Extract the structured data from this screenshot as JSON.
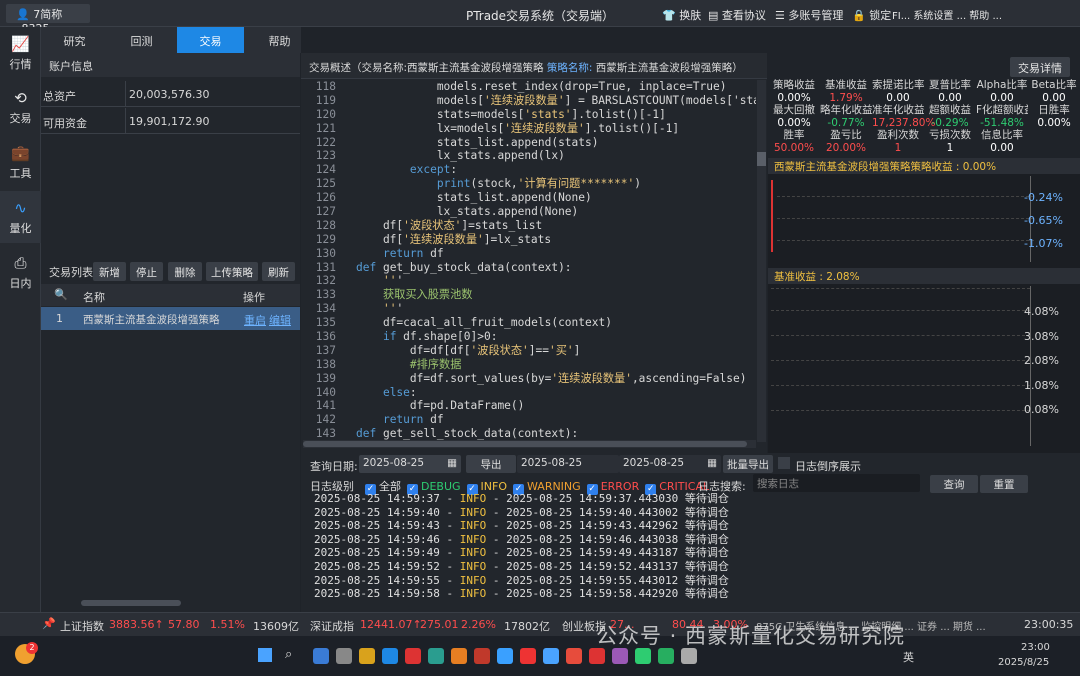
{
  "window": {
    "account": "7简称_8325",
    "title": "PTrade交易系统（交易端）",
    "toolbar": [
      "换肤",
      "查看协议",
      "多账号管理",
      "锁定"
    ],
    "toolbar_tail": "FI... 系统设置 ... 帮助 ..."
  },
  "sidebar": [
    {
      "label": "行情",
      "icon": "chart-icon"
    },
    {
      "label": "交易",
      "icon": "exchange-icon"
    },
    {
      "label": "工具",
      "icon": "toolbox-icon"
    },
    {
      "label": "量化",
      "icon": "quant-icon"
    },
    {
      "label": "日内",
      "icon": "intraday-icon"
    }
  ],
  "nav_tabs": [
    "研究",
    "回测",
    "交易",
    "帮助"
  ],
  "account": {
    "header": "账户信息",
    "rows": [
      {
        "k": "总资产",
        "v": "20,003,576.30"
      },
      {
        "k": "可用资金",
        "v": "19,901,172.90"
      }
    ]
  },
  "trade_list": {
    "title": "交易列表",
    "buttons": [
      "新增",
      "停止",
      "删除",
      "上传策略",
      "刷新"
    ],
    "columns": [
      "名称",
      "操作"
    ],
    "row": {
      "idx": "1",
      "name": "西蒙斯主流基金波段增强策略",
      "ops": [
        "重启",
        "编辑"
      ]
    }
  },
  "overview": {
    "prefix": "交易概述（交易名称:",
    "trade_name": "西蒙斯主流基金波段增强策略",
    "strategy_label": "策略名称:",
    "strategy_name": "西蒙斯主流基金波段增强策略）",
    "detail_button": "交易详情"
  },
  "code_lines": [
    {
      "n": "118",
      "t": "            models.reset_index(drop=True, inplace=True)"
    },
    {
      "n": "119",
      "t": "            models['连续波段数量'] = BARSLASTCOUNT(models['sta"
    },
    {
      "n": "120",
      "t": "            stats=models['stats'].tolist()[-1]"
    },
    {
      "n": "121",
      "t": "            lx=models['连续波段数量'].tolist()[-1]"
    },
    {
      "n": "122",
      "t": "            stats_list.append(stats)"
    },
    {
      "n": "123",
      "t": "            lx_stats.append(lx)"
    },
    {
      "n": "124",
      "t": "        except:"
    },
    {
      "n": "125",
      "t": "            print(stock,'计算有问题*******')"
    },
    {
      "n": "126",
      "t": "            stats_list.append(None)"
    },
    {
      "n": "127",
      "t": "            lx_stats.append(None)"
    },
    {
      "n": "128",
      "t": "    df['波段状态']=stats_list"
    },
    {
      "n": "129",
      "t": "    df['连续波段数量']=lx_stats"
    },
    {
      "n": "130",
      "t": "    return df"
    },
    {
      "n": "131",
      "t": "def get_buy_stock_data(context):"
    },
    {
      "n": "132",
      "t": "    '''"
    },
    {
      "n": "133",
      "t": "    获取买入股票池数"
    },
    {
      "n": "134",
      "t": "    '''"
    },
    {
      "n": "135",
      "t": "    df=cacal_all_fruit_models(context)"
    },
    {
      "n": "136",
      "t": "    if df.shape[0]>0:"
    },
    {
      "n": "137",
      "t": "        df=df[df['波段状态']=='买']"
    },
    {
      "n": "138",
      "t": "        #排序数据"
    },
    {
      "n": "139",
      "t": "        df=df.sort_values(by='连续波段数量',ascending=False)"
    },
    {
      "n": "140",
      "t": "    else:"
    },
    {
      "n": "141",
      "t": "        df=pd.DataFrame()"
    },
    {
      "n": "142",
      "t": "    return df"
    },
    {
      "n": "143",
      "t": "def get_sell_stock_data(context):"
    }
  ],
  "stats": [
    {
      "label": "策略收益",
      "value": "0.00%",
      "color": "#ffffff"
    },
    {
      "label": "基准收益",
      "value": "1.79%",
      "color": "#ff4d4d"
    },
    {
      "label": "索提诺比率",
      "value": "0.00",
      "color": "#ffffff"
    },
    {
      "label": "夏普比率",
      "value": "0.00",
      "color": "#ffffff"
    },
    {
      "label": "Alpha比率",
      "value": "0.00",
      "color": "#ffffff"
    },
    {
      "label": "Beta比率",
      "value": "0.00",
      "color": "#ffffff"
    },
    {
      "label": "最大回撤",
      "value": "0.00%",
      "color": "#ffffff"
    },
    {
      "label": "略年化收益",
      "value": "-0.77%",
      "color": "#2ecc71"
    },
    {
      "label": "准年化收益",
      "value": "17,237.80%",
      "color": "#ff4d4d"
    },
    {
      "label": "超额收益",
      "value": "-0.29%",
      "color": "#2ecc71"
    },
    {
      "label": "F化超额收益",
      "value": "-51.48%",
      "color": "#2ecc71"
    },
    {
      "label": "日胜率",
      "value": "0.00%",
      "color": "#ffffff"
    },
    {
      "label": "胜率",
      "value": "50.00%",
      "color": "#ff4d4d"
    },
    {
      "label": "盈亏比",
      "value": "20.00%",
      "color": "#ff4d4d"
    },
    {
      "label": "盈利次数",
      "value": "1",
      "color": "#ff4d4d"
    },
    {
      "label": "亏损次数",
      "value": "1",
      "color": "#ffffff"
    },
    {
      "label": "信息比率",
      "value": "0.00",
      "color": "#ffffff"
    }
  ],
  "charts": {
    "strategy_title": "西蒙斯主流基金波段增强策略策略收益 : 0.00%",
    "strategy_ticks": [
      "-0.24%",
      "-0.65%",
      "-1.07%"
    ],
    "bench_title": "基准收益 : 2.08%",
    "bench_ticks": [
      "4.08%",
      "3.08%",
      "2.08%",
      "1.08%",
      "0.08%"
    ]
  },
  "log": {
    "query_date_label": "查询日期:",
    "date1": "2025-08-25",
    "export": "导出",
    "date2": "2025-08-25",
    "date3": "2025-08-25",
    "batch_export": "批量导出",
    "reverse": "日志倒序展示",
    "level_label": "日志级别",
    "levels": [
      {
        "t": "全部",
        "c": "#dddddd"
      },
      {
        "t": "DEBUG",
        "c": "#2ecc71"
      },
      {
        "t": "INFO",
        "c": "#f0c040"
      },
      {
        "t": "WARNING",
        "c": "#f0a030"
      },
      {
        "t": "ERROR",
        "c": "#ff4d4d"
      },
      {
        "t": "CRITICAL",
        "c": "#ff4d4d"
      }
    ],
    "search_label": "日志搜索:",
    "search_placeholder": "搜索日志",
    "query": "查询",
    "reset": "重置",
    "lines": [
      {
        "ts": "2025-08-25 14:59:37",
        "t2": "2025-08-25 14:59:37.443030",
        "msg": "等待调仓"
      },
      {
        "ts": "2025-08-25 14:59:40",
        "t2": "2025-08-25 14:59:40.443002",
        "msg": "等待调仓"
      },
      {
        "ts": "2025-08-25 14:59:43",
        "t2": "2025-08-25 14:59:43.442962",
        "msg": "等待调仓"
      },
      {
        "ts": "2025-08-25 14:59:46",
        "t2": "2025-08-25 14:59:46.443038",
        "msg": "等待调仓"
      },
      {
        "ts": "2025-08-25 14:59:49",
        "t2": "2025-08-25 14:59:49.443187",
        "msg": "等待调仓"
      },
      {
        "ts": "2025-08-25 14:59:52",
        "t2": "2025-08-25 14:59:52.443137",
        "msg": "等待调仓"
      },
      {
        "ts": "2025-08-25 14:59:55",
        "t2": "2025-08-25 14:59:55.443012",
        "msg": "等待调仓"
      },
      {
        "ts": "2025-08-25 14:59:58",
        "t2": "2025-08-25 14:59:58.442920",
        "msg": "等待调仓"
      }
    ]
  },
  "status": {
    "sh_name": "上证指数",
    "sh_val": "3883.56↑",
    "sh_chg": "57.80",
    "sh_pct": "1.51%",
    "sh_amt": "13609亿",
    "sz_name": "深证成指",
    "sz_val": "12441.07↑",
    "sz_chg": "275.01",
    "sz_pct": "2.26%",
    "sz_amt": "17802亿",
    "cy_name": "创业板指",
    "cy_val": "27...",
    "cy_chg": "80.44",
    "cy_pct": "3.00%",
    "tail": "875C 卫生系统信息 ... 监控明细 ... 证券 ... 期货 ...",
    "clock": "23:00:35"
  },
  "watermark": "公众号 · 西蒙斯量化交易研究院",
  "taskbar": {
    "ime": "英",
    "time": "23:00",
    "date": "2025/8/25",
    "badge": "2"
  }
}
